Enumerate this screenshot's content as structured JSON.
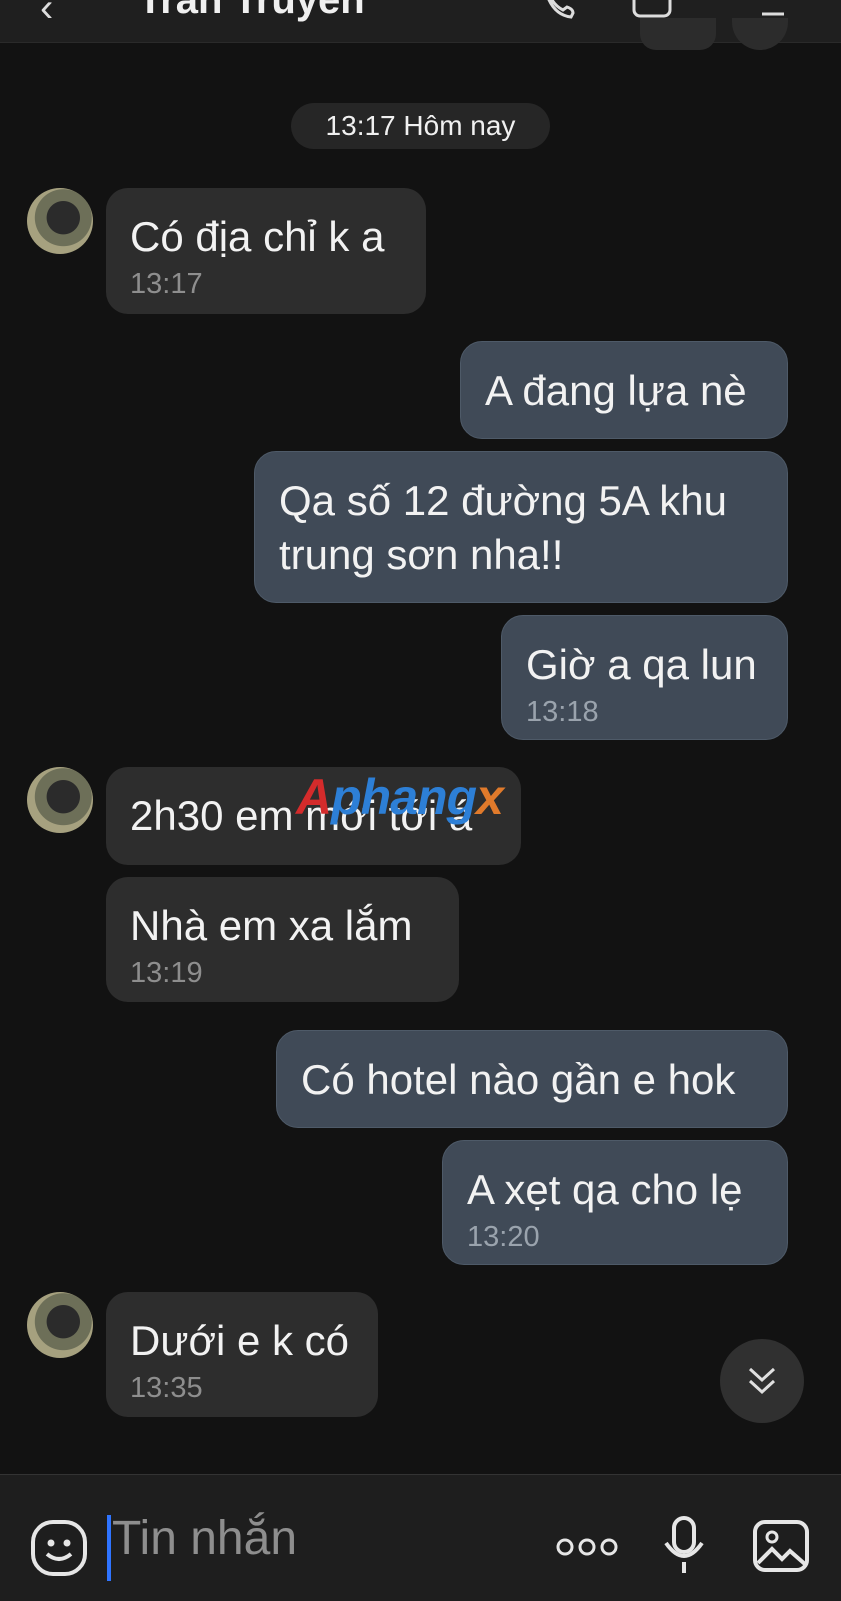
{
  "header": {
    "contact_name": "Trần Truyền"
  },
  "date_chip": "13:17 Hôm nay",
  "messages": [
    {
      "dir": "in",
      "text": "Có địa chỉ k a",
      "time": "13:17"
    },
    {
      "dir": "out",
      "text": "A đang lựa nè",
      "time": ""
    },
    {
      "dir": "out",
      "text": "Qa số 12 đường 5A khu trung sơn nha!!",
      "time": ""
    },
    {
      "dir": "out",
      "text": "Giờ a qa lun",
      "time": "13:18"
    },
    {
      "dir": "in",
      "text": "2h30 em mới tới á",
      "time": ""
    },
    {
      "dir": "in",
      "text": "Nhà em xa lắm",
      "time": "13:19"
    },
    {
      "dir": "out",
      "text": "Có hotel nào gần e hok",
      "time": ""
    },
    {
      "dir": "out",
      "text": "A xẹt qa cho lẹ",
      "time": "13:20"
    },
    {
      "dir": "in",
      "text": "Dưới e k có",
      "time": "13:35"
    }
  ],
  "watermark": {
    "p1": "A",
    "p2": "phang",
    "p3": "x"
  },
  "input": {
    "placeholder": "Tin nhắn"
  },
  "icons": {
    "back": "back-arrow-icon",
    "call": "phone-icon",
    "video": "video-icon",
    "menu": "menu-icon",
    "emoji": "emoji-icon",
    "more": "more-dots-icon",
    "mic": "microphone-icon",
    "image": "image-icon",
    "scroll": "scroll-down-icon"
  },
  "colors": {
    "background": "#121212",
    "incoming_bubble": "#2d2d2d",
    "outgoing_bubble": "#404a57",
    "cursor": "#2f74ff"
  }
}
